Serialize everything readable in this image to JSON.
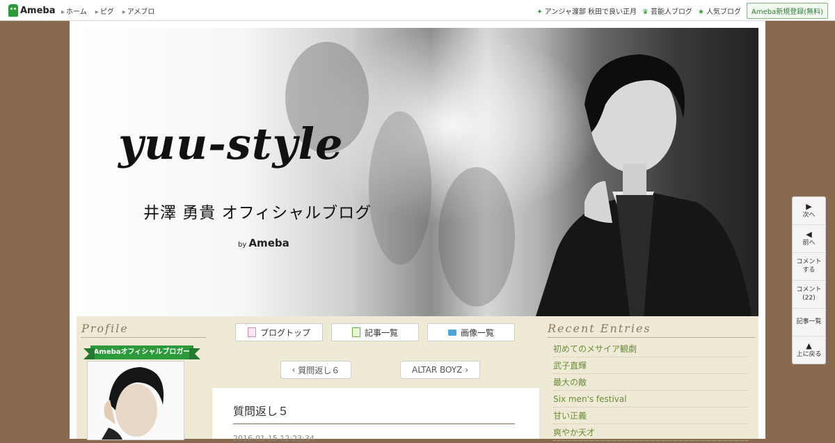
{
  "topbar": {
    "logo": "Ameba",
    "nav": [
      "ホーム",
      "ピグ",
      "アメブロ"
    ],
    "right_links": [
      {
        "icon": "sparkle-icon",
        "label": "アンジャ渡部 秋田で良い正月"
      },
      {
        "icon": "crown-icon",
        "label": "芸能人ブログ"
      },
      {
        "icon": "star-icon",
        "label": "人気ブログ"
      }
    ],
    "register": "Ameba新規登録(無料)"
  },
  "header": {
    "title": "yuu-style",
    "subtitle": "井澤 勇貴 オフィシャルブログ",
    "by": "by",
    "brand": "Ameba"
  },
  "profile": {
    "heading": "Profile",
    "badge": "Amebaオフィシャルブロガー"
  },
  "blognav": {
    "top": "ブログトップ",
    "entries": "記事一覧",
    "images": "画像一覧"
  },
  "pager": {
    "prev": "質問返し６",
    "next": "ALTAR BOYZ"
  },
  "article": {
    "title": "質問返し５",
    "date": "2016-01-15 12:23:34"
  },
  "recent": {
    "heading": "Recent Entries",
    "items": [
      "初めてのメサイア観劇",
      "武子直輝",
      "最大の敵",
      "Six men's festival",
      "甘い正義",
      "爽やか天才"
    ]
  },
  "sidenav": {
    "next": "次へ",
    "prev": "前へ",
    "comment_line1": "コメント",
    "comment_line2": "する",
    "comments_line1": "コメント",
    "comments_count": "(22)",
    "list": "記事一覧",
    "top": "上に戻る"
  },
  "colors": {
    "brand_green": "#2c9a3a",
    "background_brown": "#8a6a4e",
    "content_beige": "#eeead5",
    "link_green": "#6b8c3a"
  }
}
